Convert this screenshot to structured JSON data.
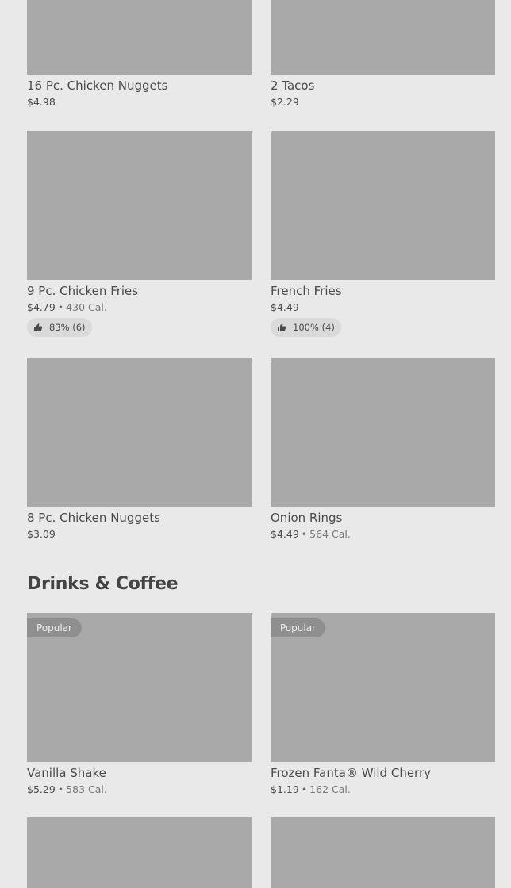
{
  "items": [
    {
      "name": "16 Pc. Chicken Nuggets",
      "price": "$4.98"
    },
    {
      "name": "2 Tacos",
      "price": "$2.29"
    },
    {
      "name": "9 Pc. Chicken Fries",
      "price": "$4.79",
      "calories": "430 Cal.",
      "rating": "83% (6)"
    },
    {
      "name": "French Fries",
      "price": "$4.49",
      "rating": "100% (4)"
    },
    {
      "name": "8 Pc. Chicken Nuggets",
      "price": "$3.09"
    },
    {
      "name": "Onion Rings",
      "price": "$4.49",
      "calories": "564 Cal."
    }
  ],
  "sections": {
    "drinks": {
      "title": "Drinks & Coffee",
      "items": [
        {
          "name": "Vanilla Shake",
          "price": "$5.29",
          "calories": "583 Cal.",
          "badge": "Popular"
        },
        {
          "name": "Frozen Fanta® Wild Cherry",
          "price": "$1.19",
          "calories": "162 Cal.",
          "badge": "Popular"
        }
      ]
    }
  },
  "separator": "•",
  "icons": {
    "rating": "thumbs-up-icon"
  },
  "colors": {
    "image_placeholder": "#a9a9a9",
    "background": "#e9e9e9",
    "badge": "#8f8f8f"
  }
}
